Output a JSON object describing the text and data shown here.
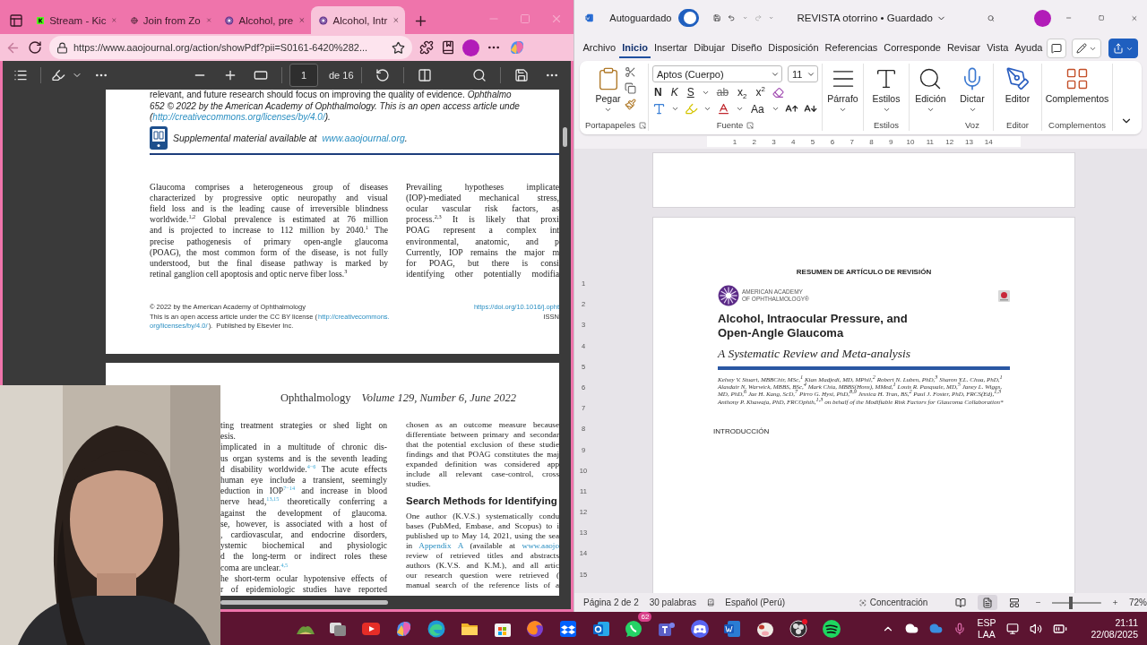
{
  "browser": {
    "tabs": [
      {
        "kind": "app",
        "title": "Stream - Kic",
        "selected": false
      },
      {
        "kind": "globe",
        "title": "Join from Zo",
        "selected": false
      },
      {
        "kind": "burst",
        "title": "Alcohol, pre",
        "selected": false
      },
      {
        "kind": "burst",
        "title": "Alcohol, Intr",
        "selected": true
      }
    ],
    "url": "https://www.aaojournal.org/action/showPdf?pii=S0161-6420%282...",
    "pdf_toolbar": {
      "page": "1",
      "total": "de 16"
    },
    "page1": {
      "abstract": [
        {
          "text": "relevant, and future research should focus on improving the quality of evidence. *Ophthalmo*",
          "italic": false
        },
        {
          "text": "652 © 2022 by the American Academy of Ophthalmology. This is an open access article unde",
          "italic": true
        }
      ],
      "abstract_link": {
        "open": "(",
        "link": "http://creativecommons.org/licenses/by/4.0/",
        "close": ")."
      },
      "supplemental": {
        "text": "Supplemental material available at",
        "link": "www.aaojournal.org",
        "end": "."
      },
      "columns": [
        [
          "Glaucoma comprises a heterogeneous group of diseases",
          "characterized by progressive optic neuropathy and visual",
          "field loss and is the leading cause of irreversible blindness",
          "worldwide.$^{1,2}$ Global prevalence is estimated at 76 million",
          "and is projected to increase to 112 million by 2040.$^{1}$ The",
          "precise pathogenesis of primary open-angle glaucoma",
          "(POAG), the most common form of the disease, is not fully",
          "understood, but the final disease pathway is marked by",
          {
            "text": "retinal ganglion cell apoptosis and optic nerve fiber loss.$^{3}$",
            "last": true
          }
        ],
        [
          "Prevailing hypotheses implicate",
          "(IOP)-mediated mechanical stress,",
          "ocular vascular risk factors, as",
          "process.$^{2,3}$ It is likely that proxi",
          "POAG represent a complex int",
          "environmental, anatomic, and p",
          "Currently, IOP remains the major m",
          "for POAG, but there is consi",
          "identifying other potentially modifia"
        ]
      ],
      "footer": {
        "copyright": "© 2022 by the American Academy of Ophthalmology",
        "license": "This is an open access article under the CC BY license (",
        "license_link": "http://creativecommons.",
        "license_link_2": "org/licenses/by/4.0/",
        "publisher": ").  Published by Elsevier Inc.",
        "doi": "https://doi.org/10.1016/j.opht",
        "issn": "ISSN"
      }
    },
    "page2": {
      "journal": "Ophthalmology",
      "issue": "Volume 129, Number 6, June 2022",
      "left": [
        "ting treatment strategies or shed light on",
        "esis.",
        "implicated in a multitude of chronic dis-",
        "us organ systems and is the seventh leading",
        "d disability worldwide.$^{4−6}$ The acute effects",
        "human eye include a transient, seemingly",
        "eduction in IOP$^{7−14}$ and increase in blood",
        "nerve head,$^{13,15}$ theoretically conferring a",
        "against the development of glaucoma.",
        "se, however, is associated with a host of",
        ", cardiovascular, and endocrine disorders,",
        "ystemic biochemical and physiologic",
        "d the long-term or indirect roles these",
        {
          "text": "coma are unclear.$^{4,5}$",
          "last": true
        },
        "he short-term ocular hypotensive effects of",
        "r of epidemiologic studies have reported"
      ],
      "right_top": [
        "chosen as an outcome measure because",
        "differentiate between primary and secondar",
        "that the potential exclusion of these studie",
        "findings and that POAG constitutes the maj",
        "expanded definition was considered app",
        "include all relevant case-control, cross",
        "studies."
      ],
      "heading": "Search Methods for Identifying",
      "right_bottom": [
        "One author (K.V.S.) systematically condu",
        "bases (PubMed, Embase, and Scopus) to i",
        "published up to May 14, 2021, using the sea",
        {
          "parts": [
            {
              "text": "in "
            },
            {
              "text": "Appendix A",
              "link": true
            },
            {
              "text": " (available at "
            },
            {
              "text": "www.aaojo",
              "link": true
            }
          ]
        },
        "review of retrieved titles and abstracts",
        "authors (K.V.S. and K.M.), and all artic",
        "our research question were retrieved (",
        "manual search of the reference lists of a"
      ]
    }
  },
  "word": {
    "autosave": {
      "label": "Autoguardado",
      "on": true
    },
    "doc_title": "REVISTA otorrino • Guardado",
    "menu": [
      {
        "label": "Archivo",
        "selected": false
      },
      {
        "label": "Inicio",
        "selected": true
      },
      {
        "label": "Insertar",
        "selected": false
      },
      {
        "label": "Dibujar",
        "selected": false
      },
      {
        "label": "Diseño",
        "selected": false
      },
      {
        "label": "Disposición",
        "selected": false
      },
      {
        "label": "Referencias",
        "selected": false
      },
      {
        "label": "Corresponde",
        "selected": false
      },
      {
        "label": "Revisar",
        "selected": false
      },
      {
        "label": "Vista",
        "selected": false
      },
      {
        "label": "Ayuda",
        "selected": false
      }
    ],
    "ribbon": {
      "paste": "Pegar",
      "clipboard_label": "Portapapeles",
      "font_name": "Aptos (Cuerpo)",
      "font_size": "11",
      "format": [
        {
          "kind": "bold",
          "text": "N"
        },
        {
          "kind": "italic",
          "text": "K"
        },
        {
          "kind": "underline",
          "text": "S"
        },
        {
          "kind": "strike",
          "text": "ab"
        },
        {
          "kind": "plain",
          "text": "x$_{2}$"
        },
        {
          "kind": "plain",
          "text": "x$^{2}$"
        }
      ],
      "case": "Aa",
      "font_label": "Fuente",
      "big": [
        {
          "kind": "paragraph",
          "text": "Párrafo",
          "caret": true
        },
        {
          "kind": "styles",
          "text": "Estilos",
          "caret": true,
          "group": "Estilos"
        },
        {
          "kind": "find",
          "text": "Edición",
          "caret": true
        },
        {
          "kind": "dictate",
          "text": "Dictar",
          "caret": true,
          "group": "Voz"
        },
        {
          "kind": "editor",
          "text": "Editor",
          "caret": false,
          "group": "Editor"
        },
        {
          "kind": "addins",
          "text": "Complementos",
          "caret": false,
          "group": "Complementos"
        }
      ]
    },
    "ruler": [
      "1",
      "2",
      "3",
      "4",
      "5",
      "6",
      "7",
      "8",
      "9",
      "10",
      "11",
      "12",
      "13",
      "14"
    ],
    "vruler": [
      "1",
      "2",
      "3",
      "4",
      "5",
      "6",
      "7",
      "8",
      "9",
      "10",
      "11",
      "12",
      "13",
      "14",
      "15"
    ],
    "doc": {
      "heading": "RESUMEN DE ARTÍCULO DE REVISIÓN",
      "org": [
        "AMERICAN ACADEMY",
        "OF OPHTHALMOLOGY®"
      ],
      "title": [
        "Alcohol, Intraocular Pressure, and",
        "Open-Angle Glaucoma"
      ],
      "subtitle": "A Systematic Review and Meta-analysis",
      "authors": "Kelsey V. Stuart, MBBChir, MSc,$^{1}$ Kian Madjedi, MD, MPhil,$^{2}$ Robert N. Luben, PhD,$^{3}$ Sharon Y.L. Chua, PhD,$^{1}$ Alasdair N. Warwick, MBBS, BSc,$^{4}$ Mark Chia, MBBS(Hons), MMed,$^{1}$ Louis R. Pasquale, MD,$^{5}$ Janey L. Wiggs, MD, PhD,$^{6}$ Jae H. Kang, ScD,$^{7}$ Pirro G. Hysi, PhD,$^{8,9}$ Jessica H. Tran, BS,$^{2}$ Paul J. Foster, PhD, FRCS(Ed),$^{1,3}$ Anthony P. Khawaja, PhD, FRCOphth,$^{1,3}$ on behalf of the Modifiable Risk Factors for Glaucoma Collaboration*",
      "section": "INTRODUCCIÓN"
    },
    "status": {
      "page": "Página 2 de 2",
      "words": "30 palabras",
      "language": "Español (Perú)",
      "focus": "Concentración",
      "views": [
        {
          "selected": false
        },
        {
          "selected": true
        },
        {
          "selected": false
        }
      ],
      "zoom": {
        "level": 0.38
      },
      "zoom_text": "72%"
    }
  },
  "taskbar": {
    "apps": [
      {
        "kind": "widgets"
      },
      {
        "kind": "taskview"
      },
      {
        "kind": "video"
      },
      {
        "kind": "swirl"
      },
      {
        "kind": "edge"
      },
      {
        "kind": "folder"
      },
      {
        "kind": "store"
      },
      {
        "kind": "fox"
      },
      {
        "kind": "box"
      },
      {
        "kind": "mail"
      },
      {
        "kind": "chat",
        "badge": "62"
      },
      {
        "kind": "people"
      },
      {
        "kind": "controller"
      },
      {
        "kind": "doc"
      },
      {
        "kind": "cow"
      },
      {
        "kind": "record"
      },
      {
        "kind": "music"
      }
    ],
    "lang": [
      "ESP",
      "LAA"
    ],
    "time": "21:11",
    "date": "22/08/2025"
  }
}
